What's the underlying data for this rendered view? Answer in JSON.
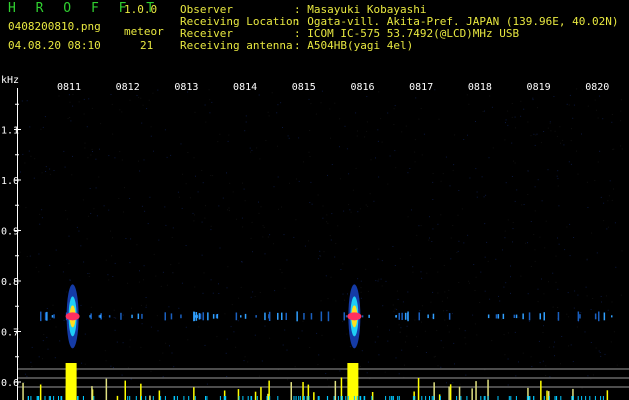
{
  "header": {
    "app_title": "H R O F F T",
    "version": "1.0.0",
    "file_name": "0408200810.png",
    "meteor_label": "meteor",
    "datetime": "04.08.20 08:10",
    "meteor_count": "21"
  },
  "info": [
    {
      "label": "Observer",
      "value": ": Masayuki Kobayashi"
    },
    {
      "label": "Receiving Location",
      "value": ": Ogata-vill. Akita-Pref. JAPAN (139.96E, 40.02N)"
    },
    {
      "label": "Receiver",
      "value": ": ICOM IC-575 53.7492(@LCD)MHz USB"
    },
    {
      "label": "Receiving antenna",
      "value": ": A504HB(yagi 4el)"
    }
  ],
  "chart_data": {
    "type": "heatmap",
    "ylabel": "kHz",
    "y_ticks": [
      "1.1",
      "1.0",
      "0.9",
      "0.8",
      "0.7",
      "0.6"
    ],
    "x_ticks": [
      "0811",
      "0812",
      "0813",
      "0814",
      "0815",
      "0816",
      "0817",
      "0818",
      "0819",
      "0820"
    ],
    "colors": {
      "time_label": "#ffffff",
      "axis": "#ffffff",
      "text": "#e8e840",
      "title": "#30d030",
      "bar": "#ffff00",
      "noise": "#00c8ff"
    },
    "echo_band_khz": 0.73,
    "strong_echoes": [
      {
        "time": "0811",
        "offset_min": 0.3
      },
      {
        "time": "0816",
        "offset_min": 0.1
      }
    ]
  }
}
